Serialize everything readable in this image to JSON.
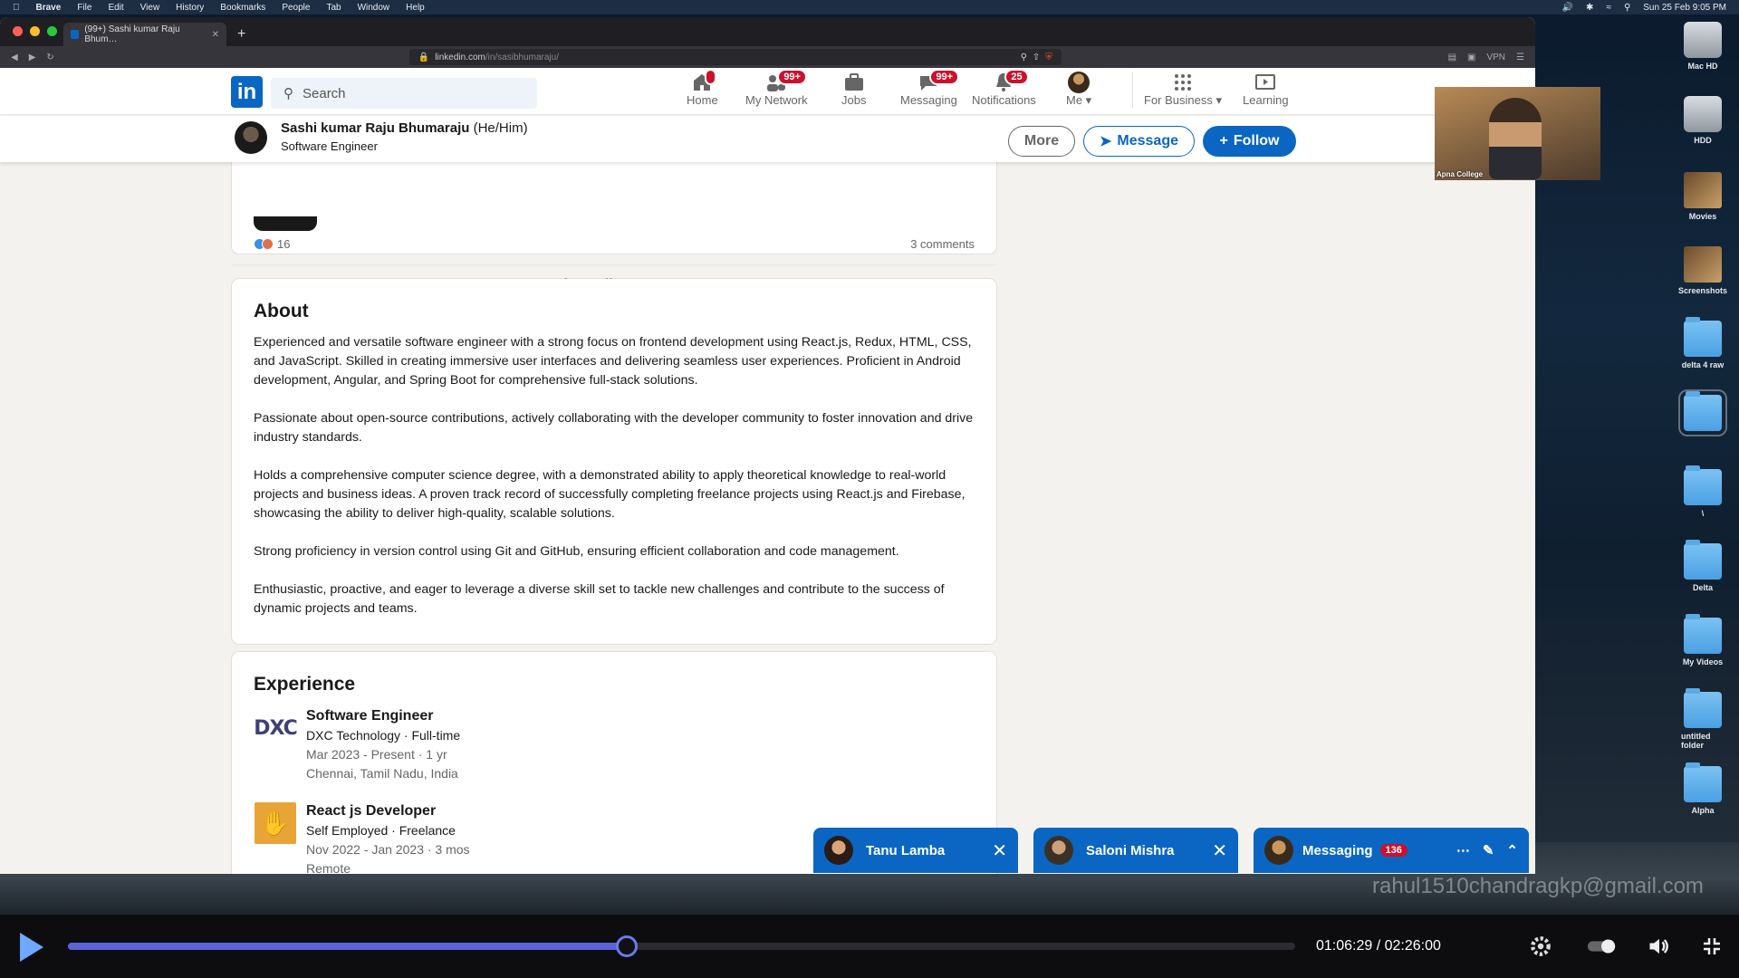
{
  "menubar": {
    "app": "Brave",
    "items": [
      "File",
      "Edit",
      "View",
      "History",
      "Bookmarks",
      "People",
      "Tab",
      "Window",
      "Help"
    ],
    "clock": "Sun 25 Feb  9:05 PM"
  },
  "browser": {
    "tab_title": "(99+) Sashi kumar Raju Bhum…",
    "url_host": "linkedin.com",
    "url_path": "/in/sasibhumaraju/",
    "vpn": "VPN"
  },
  "linkedin": {
    "logo": "in",
    "search_placeholder": "Search",
    "nav": [
      {
        "label": "Home",
        "icon": "home-icon",
        "badge": ""
      },
      {
        "label": "My Network",
        "icon": "network-icon",
        "badge": "99+"
      },
      {
        "label": "Jobs",
        "icon": "briefcase-icon",
        "badge": ""
      },
      {
        "label": "Messaging",
        "icon": "messaging-icon",
        "badge": "99+"
      },
      {
        "label": "Notifications",
        "icon": "bell-icon",
        "badge": "25"
      },
      {
        "label": "Me",
        "icon": "avatar-icon",
        "badge": ""
      },
      {
        "label": "For Business",
        "icon": "grid-icon",
        "badge": ""
      },
      {
        "label": "Learning",
        "icon": "learning-icon",
        "badge": ""
      }
    ],
    "profile": {
      "name": "Sashi kumar Raju Bhumaraju",
      "pronouns": "(He/Him)",
      "headline": "Software Engineer",
      "btn_more": "More",
      "btn_message": "Message",
      "btn_follow": "Follow"
    },
    "activity": {
      "reactions": "16",
      "comments": "3 comments",
      "show_all": "Show all posts →"
    },
    "about": {
      "heading": "About",
      "paragraphs": [
        "Experienced and versatile software engineer with a strong focus on frontend development using React.js, Redux, HTML, CSS, and JavaScript. Skilled in creating immersive user interfaces and delivering seamless user experiences. Proficient in Android development, Angular, and Spring Boot for comprehensive full-stack solutions.",
        "Passionate about open-source contributions, actively collaborating with the developer community to foster innovation and drive industry standards.",
        "Holds a comprehensive computer science degree, with a demonstrated ability to apply theoretical knowledge to real-world projects and business ideas. A proven track record of successfully completing freelance projects using React.js and Firebase, showcasing the ability to deliver high-quality, scalable solutions.",
        "Strong proficiency in version control using Git and GitHub, ensuring efficient collaboration and code management.",
        "Enthusiastic, proactive, and eager to leverage a diverse skill set to tackle new challenges and contribute to the success of dynamic projects and teams."
      ]
    },
    "experience": {
      "heading": "Experience",
      "items": [
        {
          "title": "Software Engineer",
          "company": "DXC Technology · Full-time",
          "dates": "Mar 2023 - Present · 1 yr",
          "location": "Chennai, Tamil Nadu, India",
          "logo": "DXC"
        },
        {
          "title": "React js Developer",
          "company": "Self Employed · Freelance",
          "dates": "Nov 2022 - Jan 2023 · 3 mos",
          "location": "Remote",
          "logo": "handshake"
        }
      ]
    },
    "chats": [
      {
        "name": "Tanu Lamba"
      },
      {
        "name": "Saloni Mishra"
      },
      {
        "name": "Messaging",
        "badge": "136"
      }
    ]
  },
  "webcam_label": "Apna College",
  "desktop_icons": [
    "Mac HD",
    "HDD",
    "Movies",
    "Screenshots",
    "delta 4 raw",
    "",
    "\\",
    "Delta",
    "My Videos",
    "untitled folder",
    "Alpha"
  ],
  "watermark": "rahul1510chandragkp@gmail.com",
  "player": {
    "timecode": "01:06:29 / 02:26:00",
    "progress": 0.455
  },
  "colors": {
    "linkedin_blue": "#0a66c2",
    "badge_red": "#cb112d",
    "progress": "#5b63d6"
  }
}
